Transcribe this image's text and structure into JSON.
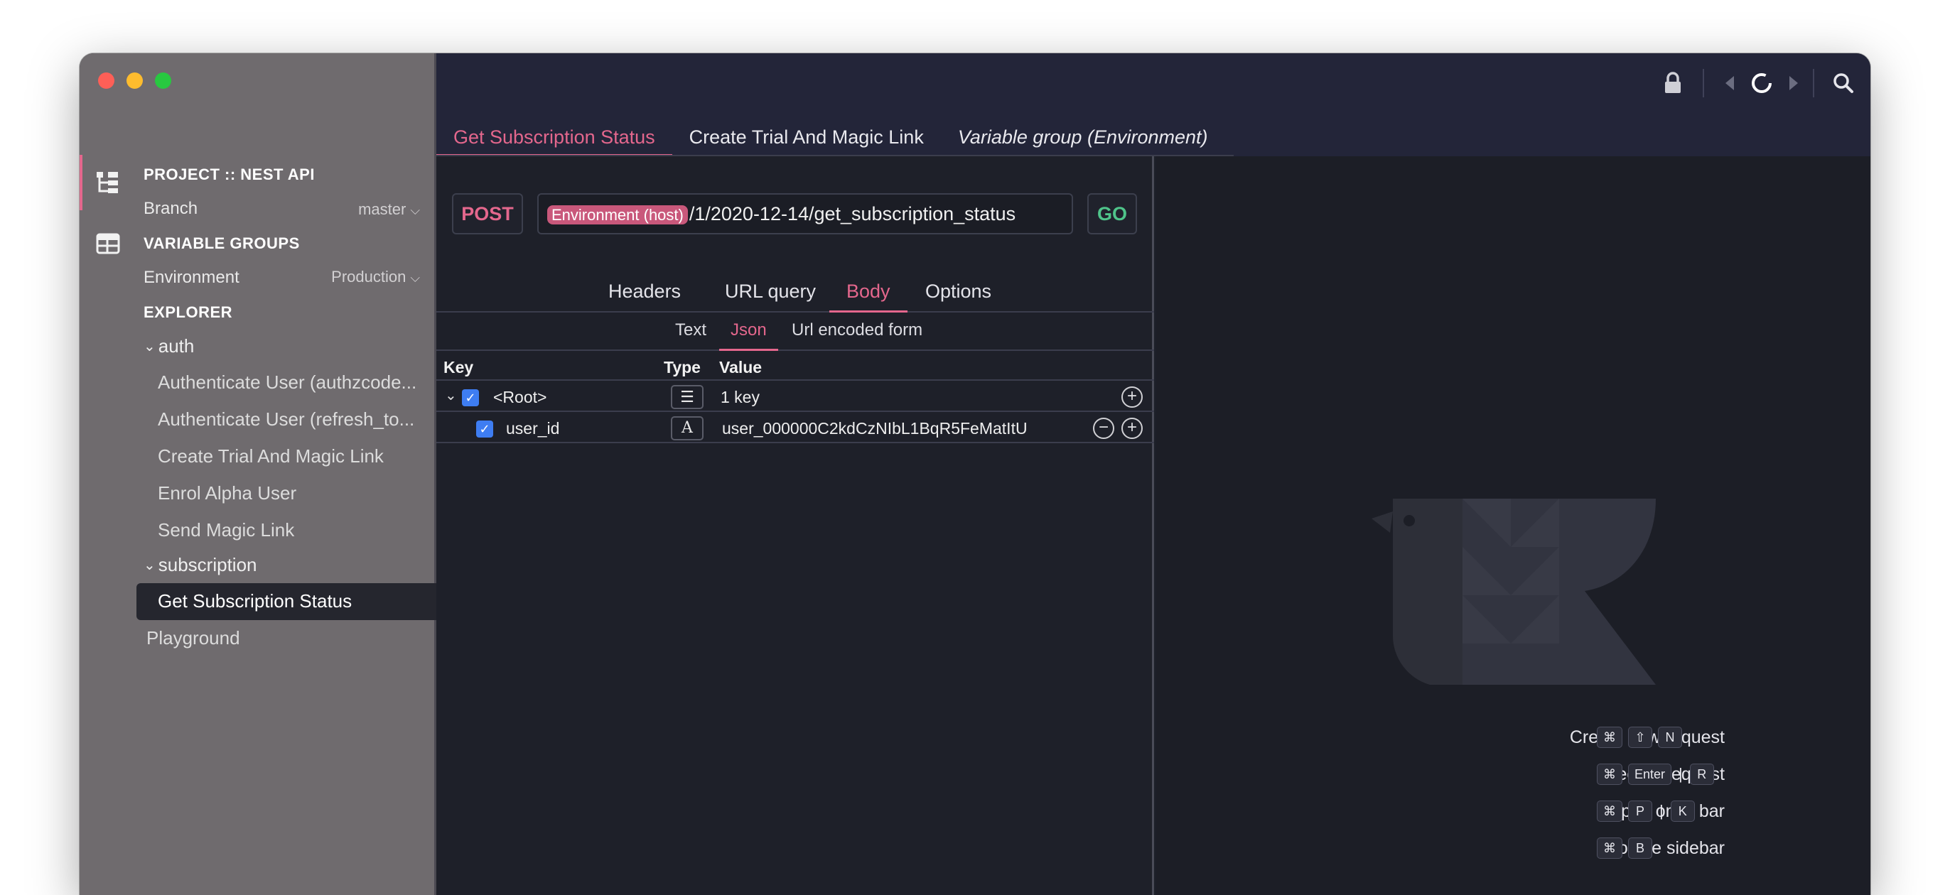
{
  "sidebar": {
    "project_heading": "PROJECT :: NEST API",
    "branch_label": "Branch",
    "branch_value": "master",
    "variable_groups_heading": "VARIABLE GROUPS",
    "environment_label": "Environment",
    "environment_value": "Production",
    "explorer_heading": "EXPLORER",
    "folders": [
      {
        "name": "auth",
        "items": [
          "Authenticate User (authzcode...",
          "Authenticate User (refresh_to...",
          "Create Trial And Magic Link",
          "Enrol Alpha User",
          "Send Magic Link"
        ]
      },
      {
        "name": "subscription",
        "items": [
          "Get Subscription Status"
        ]
      }
    ],
    "playground": "Playground"
  },
  "tabs": [
    {
      "label": "Get Subscription Status",
      "active": true
    },
    {
      "label": "Create Trial And Magic Link",
      "active": false
    },
    {
      "label": "Variable group (Environment)",
      "active": false
    }
  ],
  "request": {
    "method": "POST",
    "url_variable": "Environment (host)",
    "url_path": "/1/2020-12-14/get_subscription_status",
    "go_label": "GO",
    "subtabs": [
      "Headers",
      "URL query",
      "Body",
      "Options"
    ],
    "active_subtab": "Body",
    "body_tabs": [
      "Text",
      "Json",
      "Url encoded form"
    ],
    "active_body_tab": "Json",
    "table": {
      "headers": {
        "key": "Key",
        "type": "Type",
        "value": "Value"
      },
      "rows": [
        {
          "key": "<Root>",
          "type_icon": "list-icon",
          "type_glyph": "☰",
          "value": "1 key"
        },
        {
          "key": "user_id",
          "type_icon": "text-type-icon",
          "type_glyph": "A",
          "value": "user_000000C2kdCzNIbL1BqR5FeMatItU"
        }
      ]
    }
  },
  "shortcuts": [
    {
      "label": "Create new request",
      "keys": [
        "⌘",
        "⇧",
        "N"
      ]
    },
    {
      "label": "Execute request",
      "keys": [
        "⌘",
        "Enter",
        "|",
        "R"
      ]
    },
    {
      "label": "Open omni bar",
      "keys": [
        "⌘",
        "P",
        "|",
        "K"
      ]
    },
    {
      "label": "Toggle sidebar",
      "keys": [
        "⌘",
        "B"
      ]
    }
  ],
  "colors": {
    "accent": "#e4678d",
    "go": "#4fc48a",
    "checkbox": "#3e7df2"
  }
}
